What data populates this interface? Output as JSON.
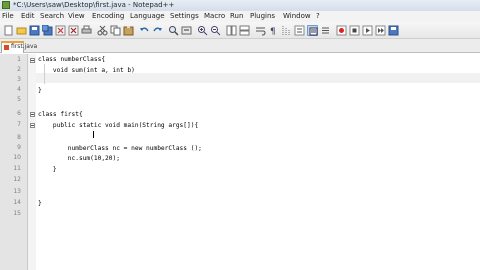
{
  "window": {
    "title": "*C:\\Users\\saw\\Desktop\\first.java - Notepad++"
  },
  "menu": [
    "File",
    "Edit",
    "Search",
    "View",
    "Encoding",
    "Language",
    "Settings",
    "Macro",
    "Run",
    "Plugins",
    "Window",
    "?"
  ],
  "toolbar_icons": [
    "new-file-icon",
    "open-file-icon",
    "save-icon",
    "save-all-icon",
    "close-icon",
    "close-all-icon",
    "print-icon",
    "cut-icon",
    "copy-icon",
    "paste-icon",
    "undo-icon",
    "redo-icon",
    "find-icon",
    "replace-icon",
    "zoom-in-icon",
    "zoom-out-icon",
    "sync-v-icon",
    "sync-h-icon",
    "word-wrap-icon",
    "show-all-chars-icon",
    "indent-guide-icon",
    "user-lang-icon",
    "doc-map-icon",
    "function-list-icon",
    "record-macro-icon",
    "stop-record-icon",
    "play-macro-icon",
    "run-macro-multiple-icon",
    "save-macro-icon"
  ],
  "tab": {
    "label": "first.java"
  },
  "editor": {
    "line_numbers": [
      "1",
      "2",
      "3",
      "4",
      "5",
      "6",
      "7",
      "8",
      "9",
      "10",
      "11",
      "12",
      "13",
      "14",
      "15"
    ],
    "lines": [
      "class numberClass{",
      "    void sum(int a, int b)",
      "",
      "}",
      "",
      "class first{",
      "    public static void main(String args[]){",
      "",
      "        numberClass nc = new numberClass ();",
      "        nc.sum(10,20);",
      "    }",
      "",
      "",
      "}",
      ""
    ]
  }
}
